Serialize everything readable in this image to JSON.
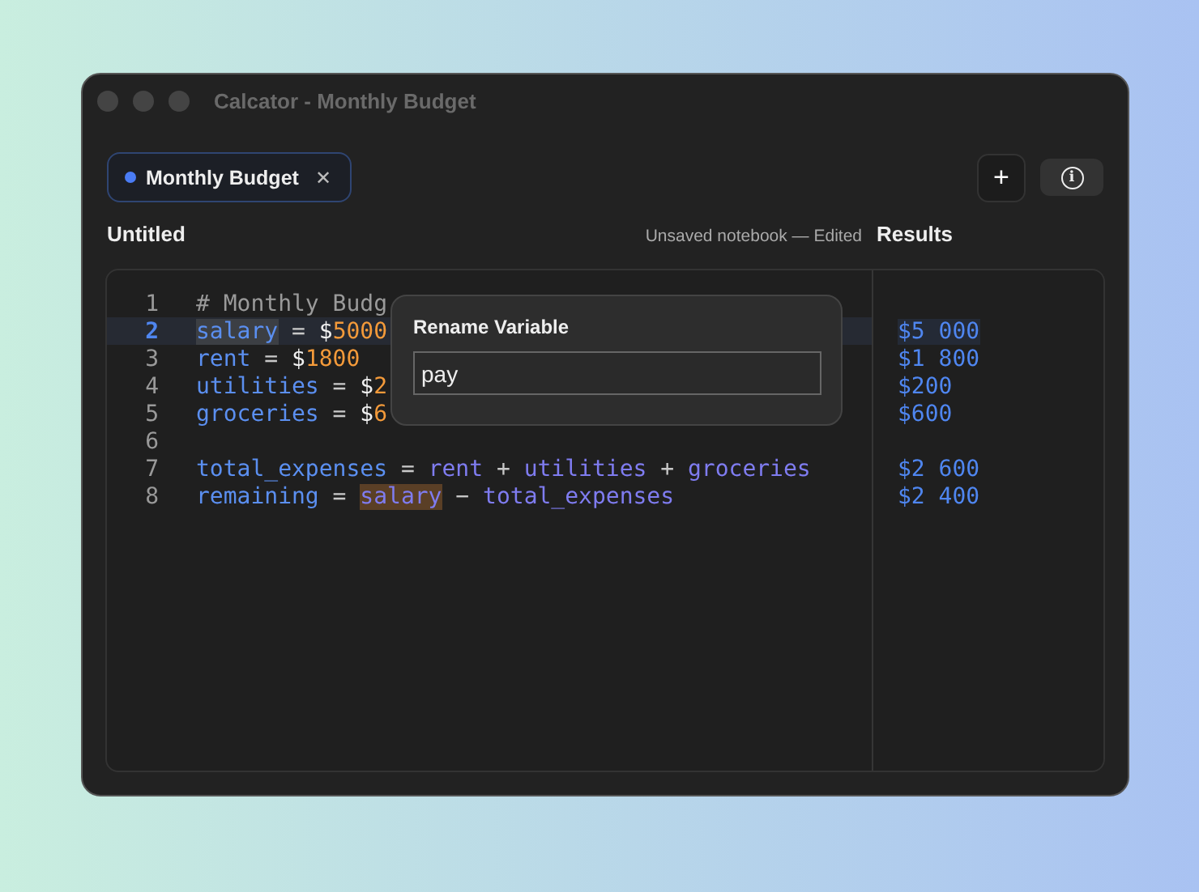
{
  "window": {
    "title": "Calcator - Monthly Budget"
  },
  "tabs": [
    {
      "label": "Monthly Budget",
      "selected": true,
      "color": "#4a7cf5",
      "close": "✕"
    }
  ],
  "toolbar": {
    "add": "+",
    "info": "i"
  },
  "editor": {
    "title": "Untitled",
    "status": "Unsaved notebook — Edited"
  },
  "results_panel": {
    "title": "Results"
  },
  "lines": [
    {
      "number": "1",
      "current": false,
      "tokens": [
        {
          "kind": "comment",
          "text": "# Monthly Budg",
          "match": false
        }
      ]
    },
    {
      "number": "2",
      "current": true,
      "result": "$5 000",
      "tokens": [
        {
          "kind": "var",
          "text": "salary",
          "match": true
        },
        {
          "kind": "op",
          "text": " = ",
          "match": false
        },
        {
          "kind": "currency",
          "text": "$",
          "match": false
        },
        {
          "kind": "num",
          "text": "5000",
          "match": false
        }
      ]
    },
    {
      "number": "3",
      "current": false,
      "result": "$1 800",
      "tokens": [
        {
          "kind": "var",
          "text": "rent",
          "match": false
        },
        {
          "kind": "op",
          "text": " = ",
          "match": false
        },
        {
          "kind": "currency",
          "text": "$",
          "match": false
        },
        {
          "kind": "num",
          "text": "1800",
          "match": false
        }
      ]
    },
    {
      "number": "4",
      "current": false,
      "result": "$200",
      "tokens": [
        {
          "kind": "var",
          "text": "utilities",
          "match": false
        },
        {
          "kind": "op",
          "text": " = ",
          "match": false
        },
        {
          "kind": "currency",
          "text": "$",
          "match": false
        },
        {
          "kind": "num",
          "text": "2",
          "match": false
        }
      ]
    },
    {
      "number": "5",
      "current": false,
      "result": "$600",
      "tokens": [
        {
          "kind": "var",
          "text": "groceries",
          "match": false
        },
        {
          "kind": "op",
          "text": " = ",
          "match": false
        },
        {
          "kind": "currency",
          "text": "$",
          "match": false
        },
        {
          "kind": "num",
          "text": "6",
          "match": false
        }
      ]
    },
    {
      "number": "6",
      "current": false
    },
    {
      "number": "7",
      "current": false,
      "result": "$2 600",
      "tokens": [
        {
          "kind": "var",
          "text": "total_expenses",
          "match": false
        },
        {
          "kind": "op",
          "text": " = ",
          "match": false
        },
        {
          "kind": "ref",
          "text": "rent",
          "match": false
        },
        {
          "kind": "op",
          "text": " + ",
          "match": false
        },
        {
          "kind": "ref",
          "text": "utilities",
          "match": false
        },
        {
          "kind": "op",
          "text": " + ",
          "match": false
        },
        {
          "kind": "ref",
          "text": "groceries",
          "match": false
        }
      ]
    },
    {
      "number": "8",
      "current": false,
      "result": "$2 400",
      "tokens": [
        {
          "kind": "var",
          "text": "remaining",
          "match": false
        },
        {
          "kind": "op",
          "text": " = ",
          "match": false
        },
        {
          "kind": "ref",
          "text": "salary",
          "match": true
        },
        {
          "kind": "op",
          "text": " − ",
          "match": false
        },
        {
          "kind": "ref",
          "text": "total_expenses",
          "match": false
        }
      ]
    }
  ],
  "rename_popup": {
    "title": "Rename Variable",
    "value": "pay"
  }
}
